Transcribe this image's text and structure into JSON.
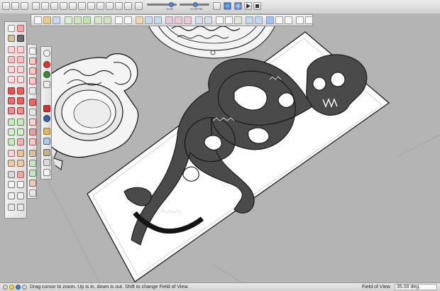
{
  "scene": {
    "time_label": "11:56",
    "time_value": "07:00 PM"
  },
  "statusbar": {
    "message": "Drag cursor to zoom.  Up is in, down is out. Shift to change Field of View.",
    "fov_label": "Field of View",
    "fov_value": "35.00 deg."
  },
  "icons": {
    "top_toolbar": [
      "select-icon",
      "eraser-icon",
      "paint-icon",
      "pencil-icon",
      "circle-icon",
      "home-icon",
      "camera-icon",
      "save-icon",
      "print-icon",
      "cube-icon",
      "paint-bucket-icon",
      "dimension-icon",
      "text-icon",
      "sun-icon",
      "play-icon",
      "rewind-icon",
      "forward-icon"
    ],
    "modeling_toolbar": [
      "select-icon",
      "component-icon",
      "move-icon",
      "push-pull-icon",
      "offset-icon",
      "follow-me-icon",
      "rotate-icon",
      "scale-icon",
      "orbit-icon",
      "pan-icon",
      "zoom-icon",
      "zoom-window-icon",
      "zoom-extents-icon",
      "previous-view-icon",
      "walk-icon",
      "look-around-icon",
      "section-plane-icon",
      "x-ray-icon",
      "wireframe-icon",
      "hidden-line-icon",
      "shaded-icon",
      "textured-icon",
      "monochrome-icon",
      "iso-view-icon",
      "top-view-icon",
      "front-view-icon",
      "right-view-icon",
      "back-view-icon",
      "left-view-icon",
      "layer-icon",
      "shadow-icon",
      "fog-icon"
    ]
  },
  "colors": {
    "background": "#b4b4b4",
    "model_face": "#ffffff",
    "model_shadow": "#4a4a4a",
    "edges": "#141414",
    "selection_blue": "#4a78c9"
  }
}
